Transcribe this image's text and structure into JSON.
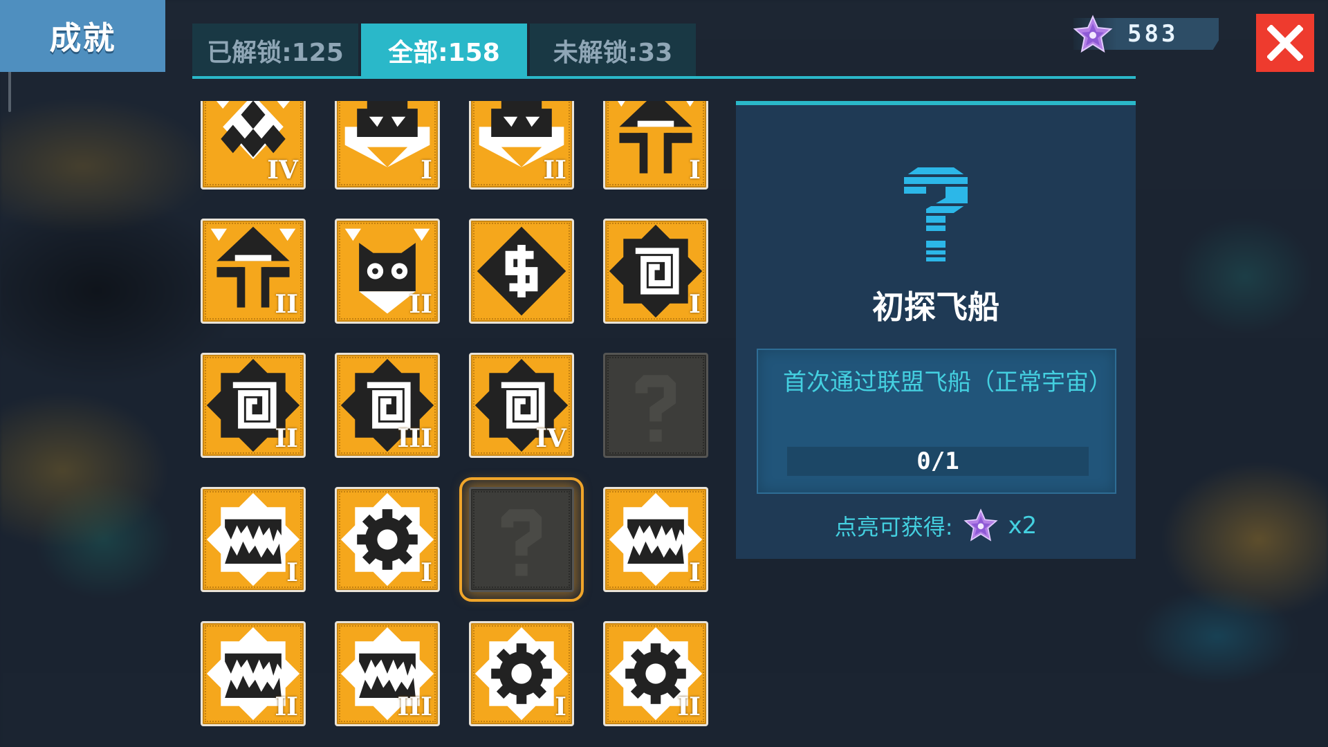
{
  "header": {
    "title": "成就",
    "tabs": [
      {
        "label": "已解锁:125",
        "active": false
      },
      {
        "label": "全部:158",
        "active": true
      },
      {
        "label": "未解锁:33",
        "active": false
      }
    ],
    "currency_value": "583",
    "currency_icon": "purple-star-icon",
    "close_icon": "close-x-icon",
    "accent_color": "#2ab8c9",
    "close_color": "#ee3b2e"
  },
  "badges": [
    {
      "icon": "diamonds-icon",
      "tier": "IV",
      "locked": false
    },
    {
      "icon": "spaceship-icon",
      "tier": "I",
      "locked": false
    },
    {
      "icon": "spaceship-icon",
      "tier": "II",
      "locked": false
    },
    {
      "icon": "robot-icon",
      "tier": "I",
      "locked": false
    },
    {
      "icon": "robot-icon",
      "tier": "II",
      "locked": false
    },
    {
      "icon": "alien-face-icon",
      "tier": "II",
      "locked": false
    },
    {
      "icon": "coin-icon",
      "tier": "",
      "locked": false
    },
    {
      "icon": "spiral-icon",
      "tier": "I",
      "locked": false
    },
    {
      "icon": "spiral-icon",
      "tier": "II",
      "locked": false
    },
    {
      "icon": "spiral-icon",
      "tier": "III",
      "locked": false
    },
    {
      "icon": "spiral-icon",
      "tier": "IV",
      "locked": false
    },
    {
      "icon": "question-icon",
      "tier": "",
      "locked": true
    },
    {
      "icon": "cave-icon",
      "tier": "I",
      "locked": false
    },
    {
      "icon": "gear-icon",
      "tier": "I",
      "locked": false
    },
    {
      "icon": "question-icon",
      "tier": "",
      "locked": true,
      "selected": true
    },
    {
      "icon": "cave-icon",
      "tier": "I",
      "locked": false
    },
    {
      "icon": "cave-icon",
      "tier": "II",
      "locked": false
    },
    {
      "icon": "cave-icon",
      "tier": "III",
      "locked": false
    },
    {
      "icon": "gear-icon",
      "tier": "I",
      "locked": false
    },
    {
      "icon": "gear-icon",
      "tier": "II",
      "locked": false
    }
  ],
  "detail": {
    "icon": "question-icon",
    "title": "初探飞船",
    "description": "首次通过联盟飞船（正常宇宙）",
    "progress_text": "0/1",
    "progress_fraction": 0,
    "reward_label": "点亮可获得:",
    "reward_icon": "purple-star-icon",
    "reward_count": "x2"
  }
}
